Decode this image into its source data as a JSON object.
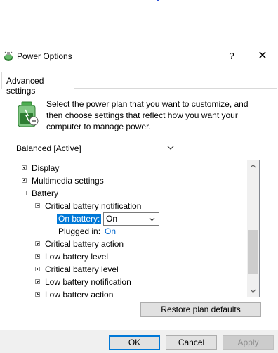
{
  "window": {
    "title": "Power Options",
    "help": "?",
    "close": "✕"
  },
  "tab": {
    "label": "Advanced settings"
  },
  "description": "Select the power plan that you want to customize, and then choose settings that reflect how you want your computer to manage power.",
  "plan": {
    "selected": "Balanced [Active]"
  },
  "tree": {
    "display": "Display",
    "multimedia": "Multimedia settings",
    "battery": "Battery",
    "critical_notification": "Critical battery notification",
    "on_battery_label": "On battery:",
    "on_battery_value": "On",
    "plugged_in_label": "Plugged in:",
    "plugged_in_value": "On",
    "critical_action": "Critical battery action",
    "low_level": "Low battery level",
    "critical_level": "Critical battery level",
    "low_notification": "Low battery notification",
    "low_action": "Low battery action"
  },
  "buttons": {
    "restore": "Restore plan defaults",
    "ok": "OK",
    "cancel": "Cancel",
    "apply": "Apply"
  },
  "colors": {
    "accent": "#0078d7",
    "link": "#0066cc"
  }
}
